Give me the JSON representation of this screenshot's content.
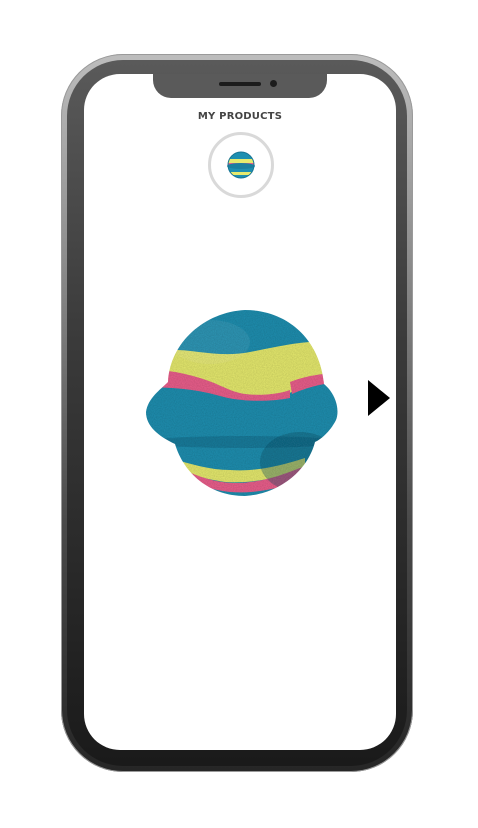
{
  "screen": {
    "title": "MY PRODUCTS"
  },
  "icons": {
    "next": "play-triangle-right-icon",
    "product_thumbnail": "bath-bomb-thumbnail",
    "product": "bath-bomb-image"
  },
  "colors": {
    "bomb_blue": "#1e8fb0",
    "bomb_yellow": "#e6ea6e",
    "bomb_pink": "#ea5f8c"
  }
}
